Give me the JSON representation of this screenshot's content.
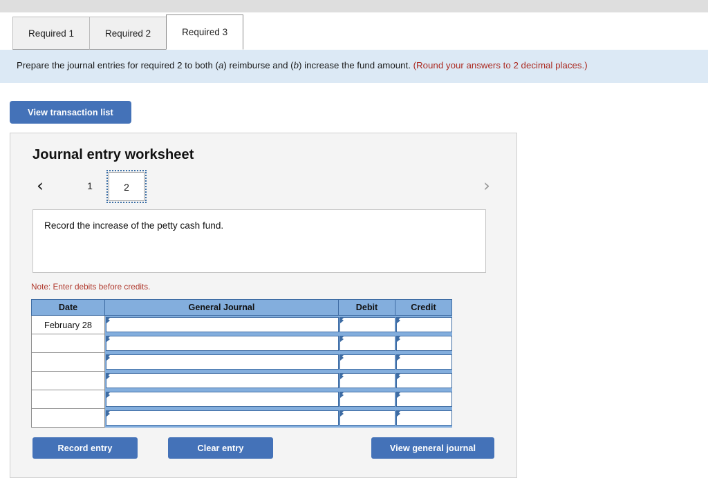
{
  "tabs": [
    {
      "label": "Required 1",
      "active": false
    },
    {
      "label": "Required 2",
      "active": false
    },
    {
      "label": "Required 3",
      "active": true
    }
  ],
  "instruction": {
    "part1": "Prepare the journal entries for required 2 to both (",
    "em1": "a",
    "part2": ") reimburse and (",
    "em2": "b",
    "part3": ") increase the fund amount. ",
    "note": "(Round your answers to 2 decimal places.)"
  },
  "toolbar": {
    "view_transaction_list_label": "View transaction list"
  },
  "worksheet": {
    "title": "Journal entry worksheet",
    "pager": {
      "prev_icon": "‹",
      "next_icon": "›",
      "pages": [
        "1",
        "2"
      ],
      "selected_page": "2"
    },
    "prompt": "Record the increase of the petty cash fund.",
    "note": "Note: Enter debits before credits.",
    "table": {
      "headers": [
        "Date",
        "General Journal",
        "Debit",
        "Credit"
      ],
      "rows": [
        {
          "date": "February 28",
          "general_journal": "",
          "debit": "",
          "credit": ""
        },
        {
          "date": "",
          "general_journal": "",
          "debit": "",
          "credit": ""
        },
        {
          "date": "",
          "general_journal": "",
          "debit": "",
          "credit": ""
        },
        {
          "date": "",
          "general_journal": "",
          "debit": "",
          "credit": ""
        },
        {
          "date": "",
          "general_journal": "",
          "debit": "",
          "credit": ""
        },
        {
          "date": "",
          "general_journal": "",
          "debit": "",
          "credit": ""
        }
      ]
    },
    "buttons": {
      "record_entry": "Record entry",
      "clear_entry": "Clear entry",
      "view_general_journal": "View general journal"
    }
  },
  "colors": {
    "accent_blue": "#4472b8",
    "table_header_blue": "#83aedd",
    "table_border_blue": "#3e6ca3",
    "banner_blue": "#dce9f5",
    "note_red": "#b03a2e",
    "instruction_red": "#ab2a21"
  }
}
